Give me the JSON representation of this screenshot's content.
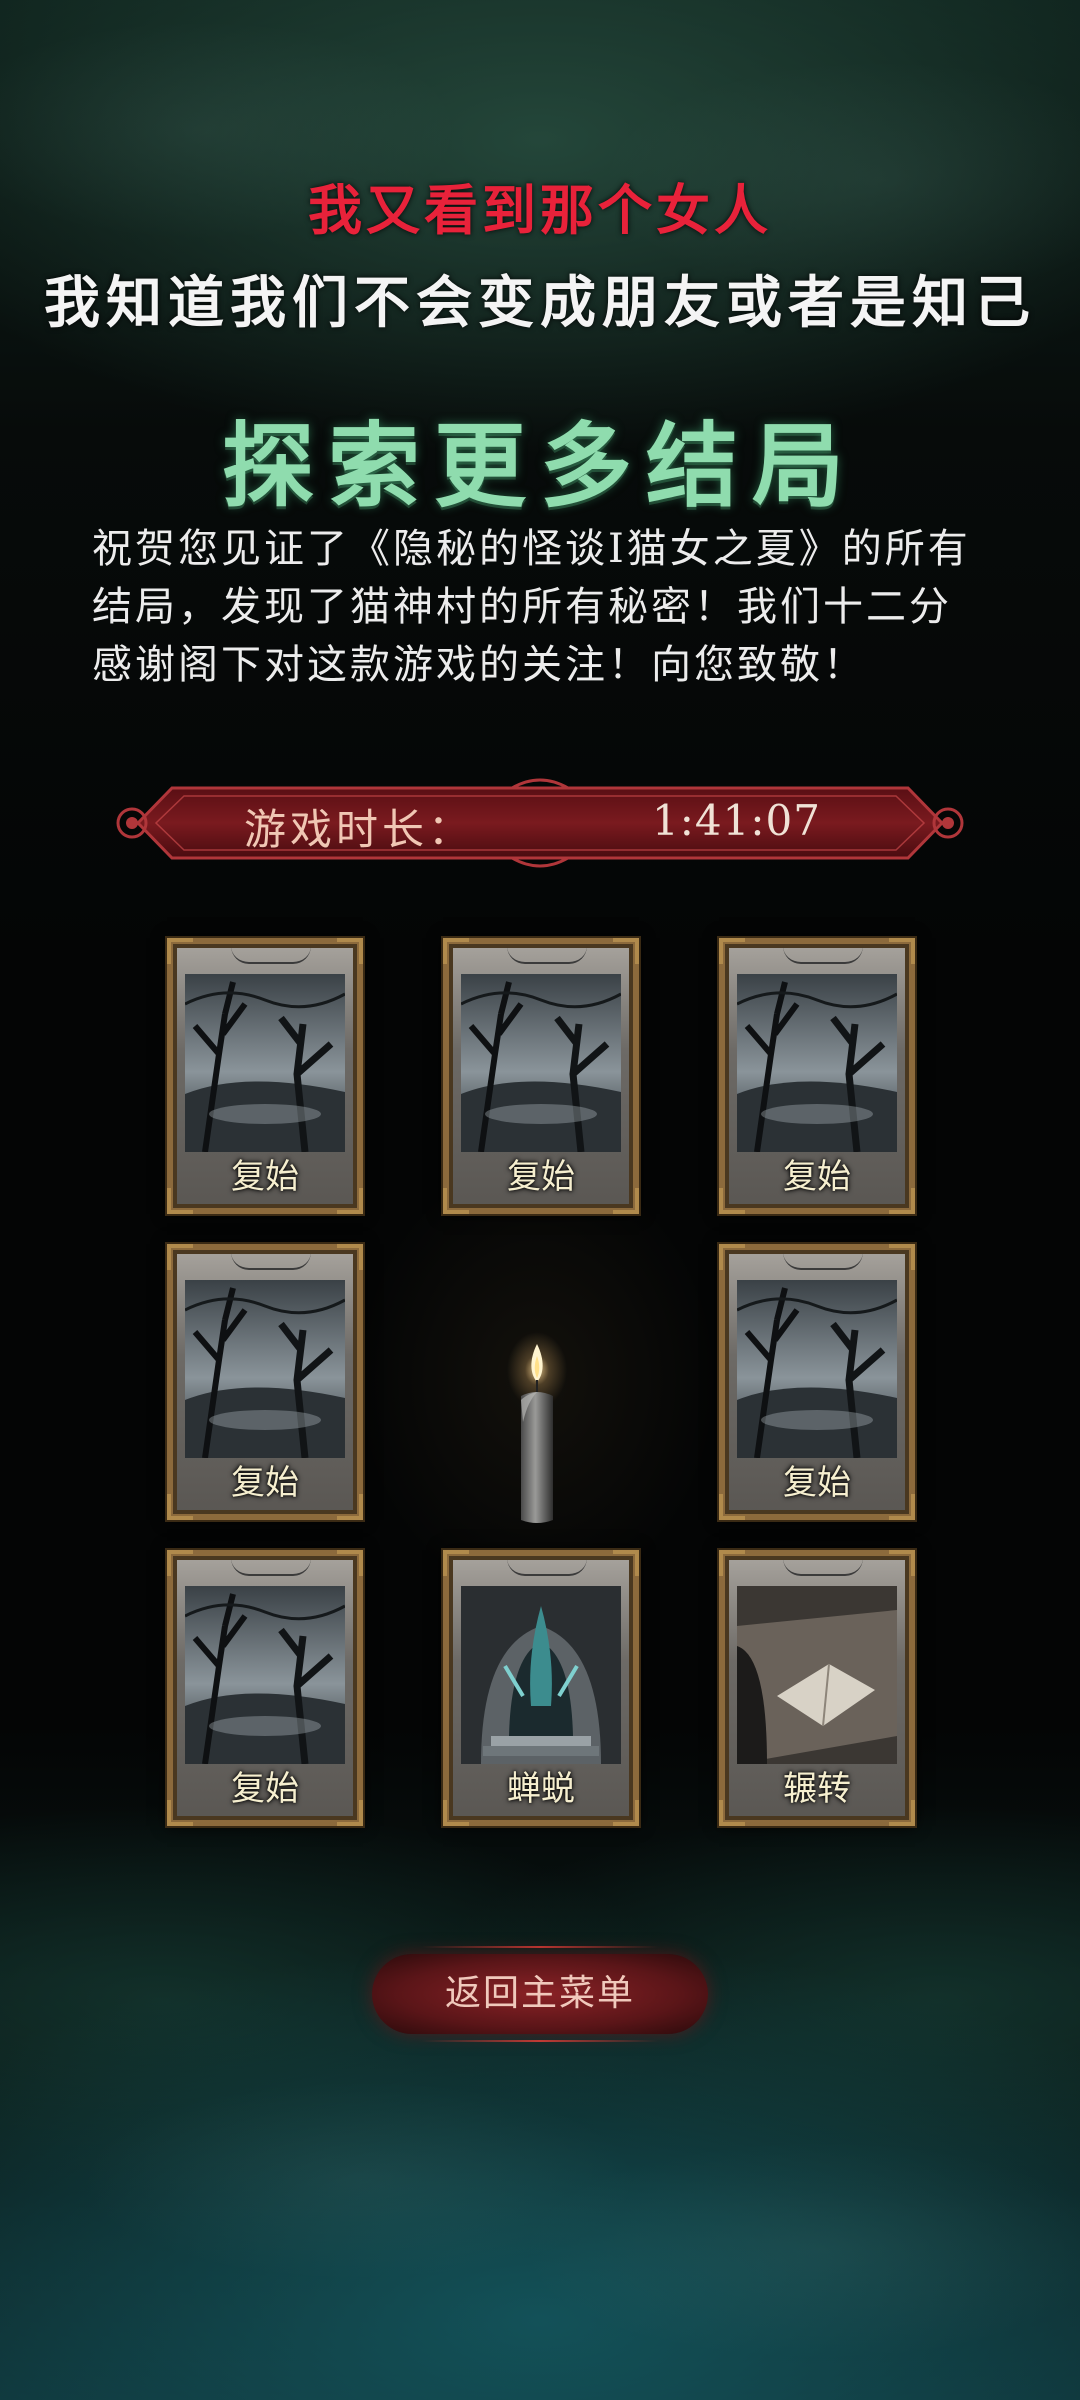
{
  "story": {
    "line_red": "我又看到那个女人",
    "line_white": "我知道我们不会变成朋友或者是知己"
  },
  "section_title": "探索更多结局",
  "congrats_text": "祝贺您见证了《隐秘的怪谈I猫女之夏》的所有结局，发现了猫神村的所有秘密！我们十二分感谢阁下对这款游戏的关注！向您致敬！",
  "playtime": {
    "label": "游戏时长：",
    "value": "1:41:07"
  },
  "endings": [
    {
      "label": "复始",
      "art": "forest-icon"
    },
    {
      "label": "复始",
      "art": "forest-icon"
    },
    {
      "label": "复始",
      "art": "forest-icon"
    },
    {
      "label": "复始",
      "art": "forest-icon"
    },
    {
      "label": "复始",
      "art": "forest-icon"
    },
    {
      "label": "复始",
      "art": "forest-icon"
    },
    {
      "label": "蝉蜕",
      "art": "cocoon-icon"
    },
    {
      "label": "辗转",
      "art": "book-icon"
    }
  ],
  "return_button_label": "返回主菜单",
  "colors": {
    "red_text": "#e8223a",
    "title_green": "#8fdcae",
    "card_frame": "#8c6a3c",
    "button_red": "#8a2226"
  }
}
